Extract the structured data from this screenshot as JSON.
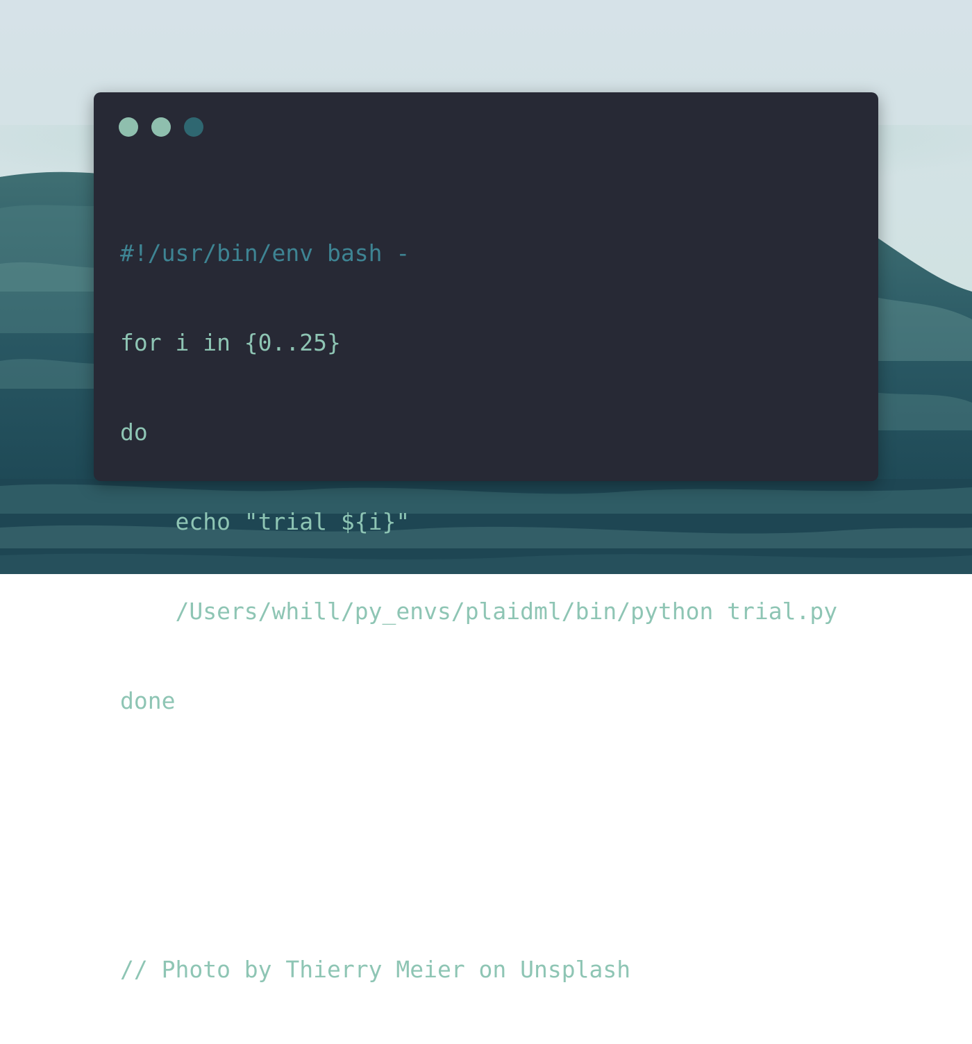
{
  "colors": {
    "sky_top": "#d3e0e6",
    "sky_bottom": "#cfe3df",
    "sea_light": "#5e8f8e",
    "sea_mid": "#2f5e68",
    "sea_dark": "#173d49",
    "window_bg": "#272935",
    "code_text": "#8ec5b4",
    "shebang_text": "#3e8493",
    "dot_1": "#8fbfae",
    "dot_2": "#8fbfae",
    "dot_3": "#2f6771"
  },
  "window": {
    "controls": [
      {
        "name": "window-dot-1",
        "color": "#8fbfae"
      },
      {
        "name": "window-dot-2",
        "color": "#8fbfae"
      },
      {
        "name": "window-dot-3",
        "color": "#2f6771"
      }
    ]
  },
  "code": {
    "shebang": "#!/usr/bin/env bash -",
    "for_line": "for i in {0..25}",
    "do_line": "do",
    "echo_line": "    echo \"trial ${i}\"",
    "python_line": "    /Users/whill/py_envs/plaidml/bin/python trial.py",
    "done_line": "done",
    "credit": "// Photo by Thierry Meier on Unsplash"
  }
}
